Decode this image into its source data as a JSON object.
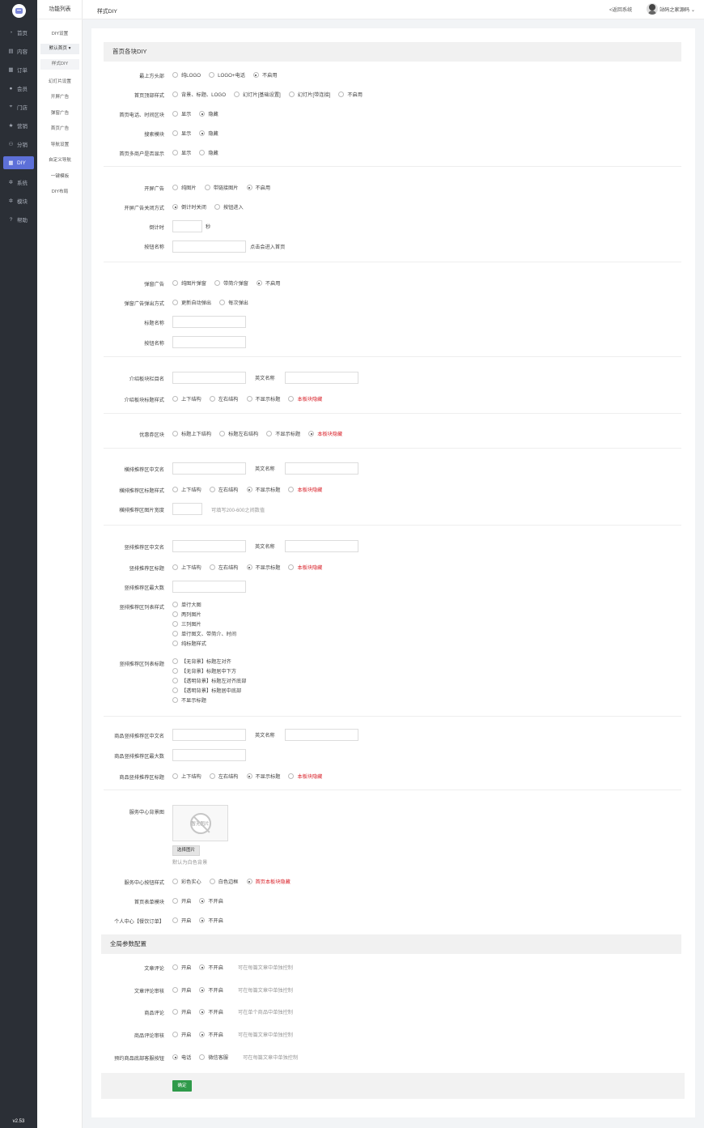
{
  "nav": {
    "items": [
      {
        "label": "首页",
        "icon": "gauge-icon",
        "glyph": "◔"
      },
      {
        "label": "内容",
        "icon": "content-icon",
        "glyph": "▤"
      },
      {
        "label": "订单",
        "icon": "order-icon",
        "glyph": "▦"
      },
      {
        "label": "会员",
        "icon": "member-icon",
        "glyph": "●"
      },
      {
        "label": "门店",
        "icon": "store-icon",
        "glyph": "⌖"
      },
      {
        "label": "营销",
        "icon": "marketing-icon",
        "glyph": "★"
      },
      {
        "label": "分销",
        "icon": "distribution-icon",
        "glyph": "⚇"
      },
      {
        "label": "DIY",
        "icon": "diy-icon",
        "glyph": "▦"
      },
      {
        "label": "系统",
        "icon": "system-icon",
        "glyph": "✲"
      },
      {
        "label": "模块",
        "icon": "module-icon",
        "glyph": "✲"
      },
      {
        "label": "帮助",
        "icon": "help-icon",
        "glyph": "?"
      }
    ],
    "version": "v2.53",
    "active_color": "#5d70d8"
  },
  "sub": {
    "title": "功能列表",
    "items": [
      "DIY设置",
      "默认首页",
      "样式DIY",
      "幻灯片设置",
      "开屏广告",
      "弹窗广告",
      "首页广告",
      "导航设置",
      "自定义导航",
      "一键模板",
      "DIY布局"
    ]
  },
  "top": {
    "crumb": "样式DIY",
    "back": "<返回系统",
    "user": "站码之家源码"
  },
  "section1": {
    "title": "首页各块DIY"
  },
  "rows": {
    "r1": {
      "label": "最上方头部",
      "opts": [
        "纯LOGO",
        "LOGO+电话",
        "不启用"
      ]
    },
    "r2": {
      "label": "首页顶部样式",
      "opts": [
        "背景、标题、LOGO",
        "幻灯片[基础设置]",
        "幻灯片[带连接]",
        "不启用"
      ]
    },
    "r3": {
      "label": "首页电话、时间区块",
      "opts": [
        "显示",
        "隐藏"
      ]
    },
    "r4": {
      "label": "搜索模块",
      "opts": [
        "显示",
        "隐藏"
      ]
    },
    "r5": {
      "label": "首页多商户是否显示",
      "opts": [
        "显示",
        "隐藏"
      ]
    },
    "r6": {
      "label": "开屏广告",
      "opts": [
        "纯图片",
        "带链接图片",
        "不启用"
      ]
    },
    "r7": {
      "label": "开屏广告关闭方式",
      "opts": [
        "倒计时关闭",
        "按钮进入"
      ]
    },
    "r8": {
      "label": "倒计时",
      "unit": "秒"
    },
    "r9": {
      "label": "按钮名称",
      "note": "点击会进入首页"
    },
    "r10": {
      "label": "弹窗广告",
      "opts": [
        "纯图片弹窗",
        "带简介弹窗",
        "不启用"
      ]
    },
    "r11": {
      "label": "弹窗广告弹出方式",
      "opts": [
        "更新自动弹出",
        "每次弹出"
      ]
    },
    "r12": {
      "label": "标题名称"
    },
    "r13": {
      "label": "按钮名称"
    },
    "r14": {
      "label": "介绍板块栏目名",
      "en": "英文名称"
    },
    "r15": {
      "label": "介绍板块标题样式",
      "opts": [
        "上下结构",
        "左右结构",
        "不显示标题",
        "本板块隐藏"
      ]
    },
    "r16": {
      "label": "优惠券区块",
      "opts": [
        "标题上下结构",
        "标题左右结构",
        "不显示标题",
        "本板块隐藏"
      ]
    },
    "r17": {
      "label": "横排推荐区中文名",
      "en": "英文名称"
    },
    "r18": {
      "label": "横排推荐区标题样式",
      "opts": [
        "上下结构",
        "左右结构",
        "不显示标题",
        "本板块隐藏"
      ]
    },
    "r19": {
      "label": "横排推荐区图片宽度",
      "note": "可填写200-600之间数值"
    },
    "r20": {
      "label": "竖排推荐区中文名",
      "en": "英文名称"
    },
    "r21": {
      "label": "竖排推荐区标题",
      "opts": [
        "上下结构",
        "左右结构",
        "不显示标题",
        "本板块隐藏"
      ]
    },
    "r22": {
      "label": "竖排推荐区最大数"
    },
    "r23": {
      "label": "竖排推荐区列表样式",
      "opts": [
        "单行大图",
        "两列图片",
        "三列图片",
        "单行图文、带简介、时间",
        "纯标题样式"
      ]
    },
    "r24": {
      "label": "竖排推荐区列表标题",
      "opts": [
        "【无背景】标题左对齐",
        "【无背景】标题居中下方",
        "【透明背景】标题左对齐底部",
        "【透明背景】标题居中底部",
        "不显示标题"
      ]
    },
    "r25": {
      "label": "商品竖排推荐区中文名",
      "en": "英文名称"
    },
    "r26": {
      "label": "商品竖排推荐区最大数"
    },
    "r27": {
      "label": "商品竖排推荐区标题",
      "opts": [
        "上下结构",
        "左右结构",
        "不显示标题",
        "本板块隐藏"
      ]
    },
    "r28": {
      "label": "服务中心背景图",
      "noimg": "暂无图片",
      "btn": "选择图片",
      "note": "默认为白色背景"
    },
    "r29": {
      "label": "服务中心按钮样式",
      "opts": [
        "彩色实心",
        "白色边框",
        "首页本板块隐藏"
      ]
    },
    "r30": {
      "label": "首页表单模块",
      "opts": [
        "开启",
        "不开启"
      ]
    },
    "r31": {
      "label": "个人中心【餐饮订单】",
      "opts": [
        "开启",
        "不开启"
      ]
    }
  },
  "section2": {
    "title": "全局参数配置"
  },
  "grows": {
    "g1": {
      "label": "文章评论",
      "opts": [
        "开启",
        "不开启"
      ],
      "note": "可在每篇文章中单独控制"
    },
    "g2": {
      "label": "文章评论审核",
      "opts": [
        "开启",
        "不开启"
      ],
      "note": "可在每篇文章中单独控制"
    },
    "g3": {
      "label": "商品评论",
      "opts": [
        "开启",
        "不开启"
      ],
      "note": "可在单个商品中单独控制"
    },
    "g4": {
      "label": "商品评论审核",
      "opts": [
        "开启",
        "不开启"
      ],
      "note": "可在每篇文章中单独控制"
    },
    "g5": {
      "label": "预约商品底部客服按钮",
      "opts": [
        "电话",
        "微信客服"
      ],
      "note": "可在每篇文章中单独控制"
    }
  },
  "submit": {
    "label": "确定",
    "color": "#2f9a4a"
  }
}
